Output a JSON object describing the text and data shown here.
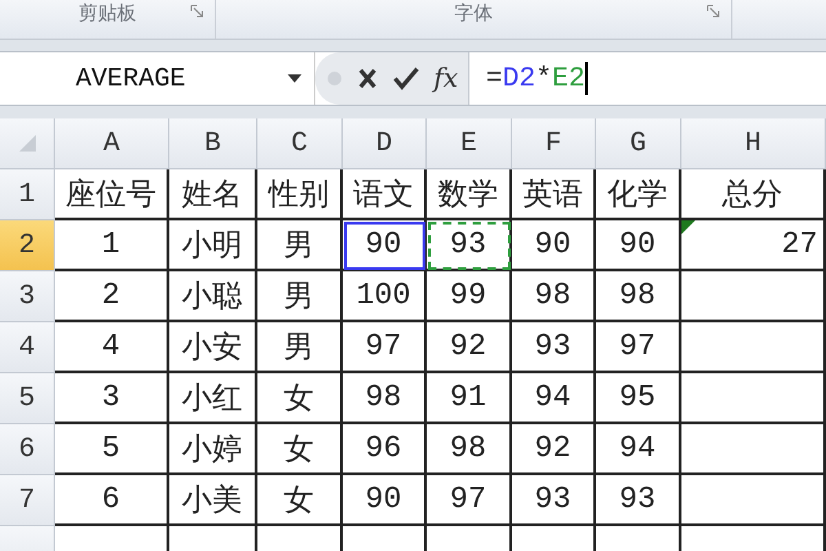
{
  "ribbon_groups": [
    {
      "label": "剪贴板"
    },
    {
      "label": "字体"
    }
  ],
  "formula_bar": {
    "name_box": "AVERAGE",
    "function_button": "fx",
    "formula": [
      {
        "text": "=",
        "color": "#222222"
      },
      {
        "text": "D2",
        "color": "#3a3af0"
      },
      {
        "text": "*",
        "color": "#222222"
      },
      {
        "text": "E2",
        "color": "#2e9e3e"
      }
    ]
  },
  "table": {
    "columns": [
      "A",
      "B",
      "C",
      "D",
      "E",
      "F",
      "G",
      "H"
    ],
    "rows": [
      {
        "number": "1",
        "selected": false,
        "cells": [
          "座位号",
          "姓名",
          "性别",
          "语文",
          "数学",
          "英语",
          "化学",
          "总分"
        ]
      },
      {
        "number": "2",
        "selected": true,
        "cells": [
          "1",
          "小明",
          "男",
          {
            "text": "90",
            "kind": "solid",
            "color": "#3a3af0"
          },
          {
            "text": "93",
            "kind": "dashed",
            "color": "#2e9e3e"
          },
          "90",
          "90",
          {
            "text": "27",
            "kind": "flagged",
            "color": "#1e7a1e"
          }
        ]
      },
      {
        "number": "3",
        "selected": false,
        "cells": [
          "2",
          "小聪",
          "男",
          "100",
          "99",
          "98",
          "98",
          ""
        ]
      },
      {
        "number": "4",
        "selected": false,
        "cells": [
          "4",
          "小安",
          "男",
          "97",
          "92",
          "93",
          "97",
          ""
        ]
      },
      {
        "number": "5",
        "selected": false,
        "cells": [
          "3",
          "小红",
          "女",
          "98",
          "91",
          "94",
          "95",
          ""
        ]
      },
      {
        "number": "6",
        "selected": false,
        "cells": [
          "5",
          "小婷",
          "女",
          "96",
          "98",
          "92",
          "94",
          ""
        ]
      },
      {
        "number": "7",
        "selected": false,
        "cells": [
          "6",
          "小美",
          "女",
          "90",
          "97",
          "93",
          "93",
          ""
        ]
      }
    ]
  }
}
